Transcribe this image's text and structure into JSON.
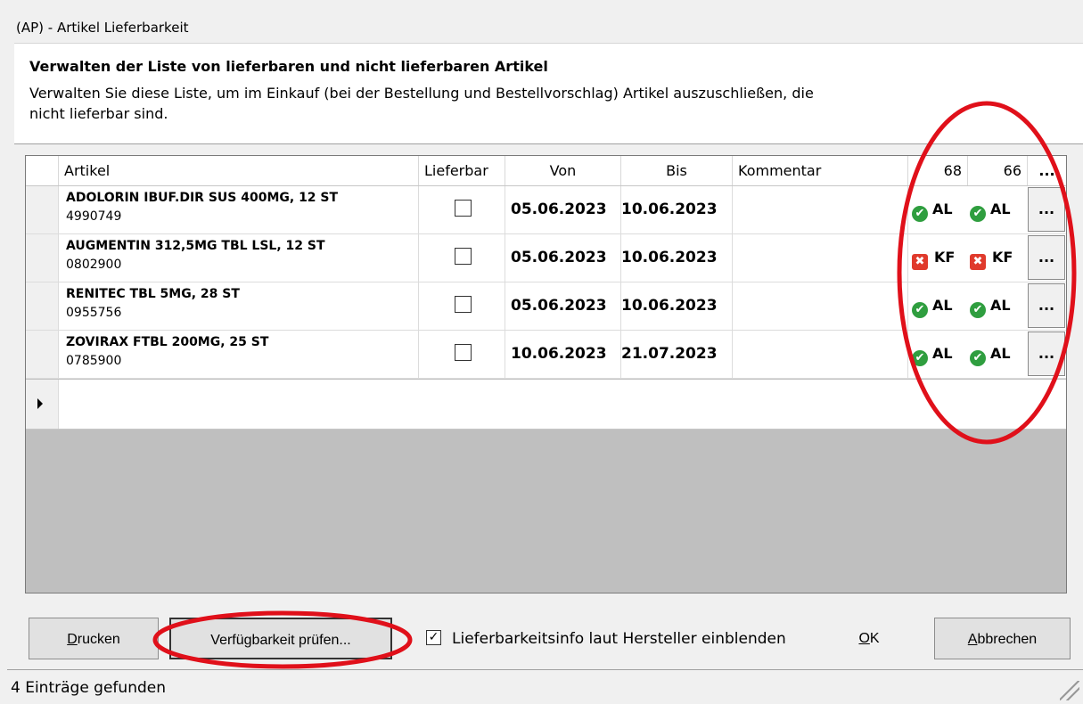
{
  "window": {
    "title": "(AP) - Artikel Lieferbarkeit"
  },
  "header": {
    "title": "Verwalten der Liste von lieferbaren und nicht lieferbaren Artikel",
    "description": "Verwalten Sie diese Liste, um im Einkauf (bei der Bestellung und Bestellvorschlag) Artikel auszuschließen, die nicht lieferbar sind."
  },
  "grid": {
    "columns": {
      "artikel": "Artikel",
      "lieferbar": "Lieferbar",
      "von": "Von",
      "bis": "Bis",
      "kommentar": "Kommentar",
      "c68": "68",
      "c66": "66",
      "more": "..."
    },
    "rows": [
      {
        "name": "ADOLORIN IBUF.DIR SUS 400MG, 12 ST",
        "code": "4990749",
        "lieferbar": false,
        "von": "05.06.2023",
        "bis": "10.06.2023",
        "kommentar": "",
        "s68": "AL",
        "s68_icon": "check-icon",
        "s66": "AL",
        "s66_icon": "check-icon",
        "btn": "..."
      },
      {
        "name": "AUGMENTIN 312,5MG TBL LSL, 12 ST",
        "code": "0802900",
        "lieferbar": false,
        "von": "05.06.2023",
        "bis": "10.06.2023",
        "kommentar": "",
        "s68": "KF",
        "s68_icon": "cross-icon",
        "s66": "KF",
        "s66_icon": "cross-icon",
        "btn": "..."
      },
      {
        "name": "RENITEC TBL 5MG, 28 ST",
        "code": "0955756",
        "lieferbar": false,
        "von": "05.06.2023",
        "bis": "10.06.2023",
        "kommentar": "",
        "s68": "AL",
        "s68_icon": "check-icon",
        "s66": "AL",
        "s66_icon": "check-icon",
        "btn": "..."
      },
      {
        "name": "ZOVIRAX FTBL 200MG, 25 ST",
        "code": "0785900",
        "lieferbar": false,
        "von": "10.06.2023",
        "bis": "21.07.2023",
        "kommentar": "",
        "s68": "AL",
        "s68_icon": "check-icon",
        "s66": "AL",
        "s66_icon": "check-icon",
        "btn": "..."
      }
    ]
  },
  "footer": {
    "print": {
      "u": "D",
      "rest": "rucken"
    },
    "check": "Verfügbarkeit prüfen...",
    "checkbox_checked": true,
    "checkbox_label": "Lieferbarkeitsinfo laut Hersteller einblenden",
    "ok": {
      "u": "O",
      "rest": "K"
    },
    "cancel": {
      "u": "A",
      "rest": "bbrechen"
    }
  },
  "status": {
    "text": "4 Einträge gefunden"
  },
  "colors": {
    "check": "#2f9e3f",
    "cross": "#e03a2c",
    "annotation": "#e0101a"
  }
}
